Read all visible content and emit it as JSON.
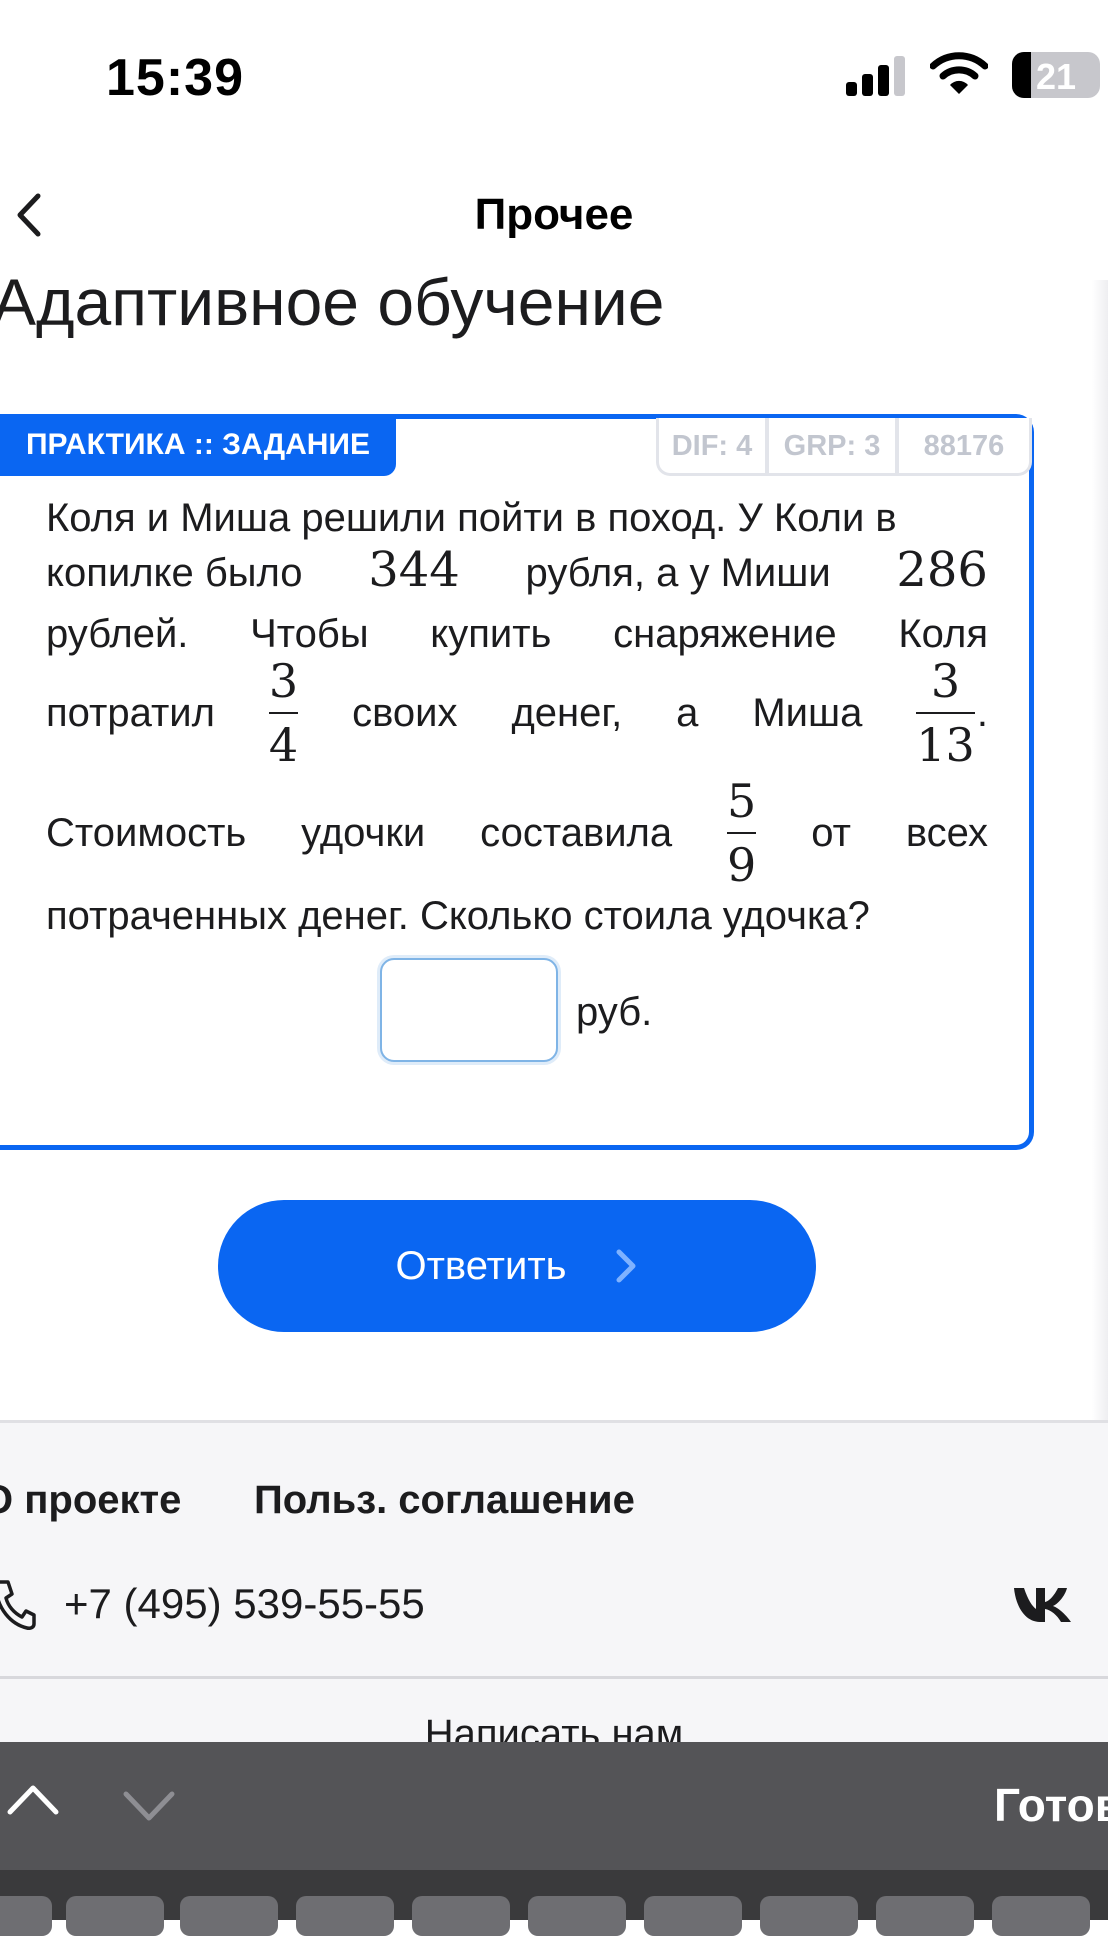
{
  "status_bar": {
    "time": "15:39",
    "battery": "21"
  },
  "nav": {
    "title": "Прочее"
  },
  "page": {
    "title": "Адаптивное обучение"
  },
  "task": {
    "badge": "ПРАКТИКА :: ЗАДАНИЕ",
    "dif": "DIF: 4",
    "grp": "GRP: 3",
    "id": "88176",
    "line1": "Коля и Миша решили пойти в поход. У Коли в",
    "line2_a": "копилке было",
    "n1": "344",
    "line2_b": "рубля, а у Миши",
    "n2": "286",
    "line3_words": [
      "рублей.",
      "Чтобы",
      "купить",
      "снаряжение",
      "Коля"
    ],
    "line4_a": "потратил",
    "f1_num": "3",
    "f1_den": "4",
    "line4_b": "своих",
    "line4_c": "денег,",
    "line4_d": "а",
    "line4_e": "Миша",
    "f2_num": "3",
    "f2_den": "13",
    "f2_after": ".",
    "line5_words": [
      "Стоимость",
      "удочки",
      "составила"
    ],
    "f3_num": "5",
    "f3_den": "9",
    "line5_after": [
      "от",
      "всех"
    ],
    "line6": "потраченных денег. Сколько стоила удочка?",
    "answer_value": "",
    "unit": "руб."
  },
  "submit": {
    "label": "Ответить"
  },
  "footer": {
    "about": "О проекте",
    "terms": "Польз. соглашение",
    "phone": "+7 (495) 539-55-55",
    "write": "Написать нам"
  },
  "keyboard": {
    "done": "Готово"
  },
  "colors": {
    "accent": "#0a66f2",
    "meta_text": "#c2c6cf",
    "keyboard_bar": "#545457"
  }
}
